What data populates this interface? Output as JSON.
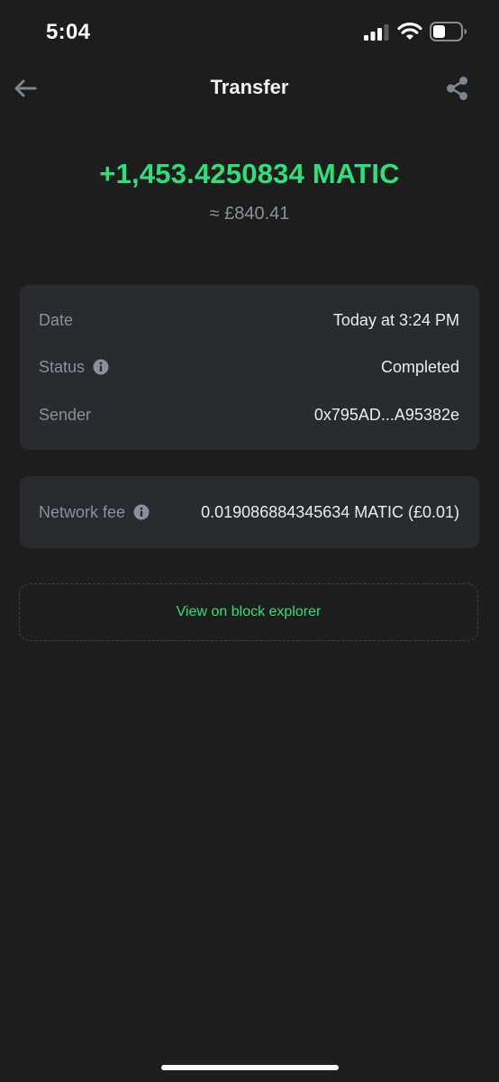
{
  "status_bar": {
    "time": "5:04",
    "icons": [
      "moon-icon",
      "cellular-signal-icon",
      "wifi-icon",
      "battery-icon"
    ]
  },
  "nav": {
    "title": "Transfer",
    "back_icon": "arrow-left-icon",
    "share_icon": "share-icon"
  },
  "transaction": {
    "amount": "+1,453.4250834 MATIC",
    "fiat_value": "≈ £840.41"
  },
  "details": {
    "date_label": "Date",
    "date_value": "Today at 3:24 PM",
    "status_label": "Status",
    "status_value": "Completed",
    "sender_label": "Sender",
    "sender_value": "0x795AD...A95382e"
  },
  "fee": {
    "label": "Network fee",
    "value": "0.019086884345634 MATIC (£0.01)"
  },
  "actions": {
    "explorer_label": "View on block explorer"
  },
  "colors": {
    "background": "#1d1d1d",
    "card": "#2a2b2e",
    "accent_green": "#2ee07a",
    "muted_text": "#8a8f99",
    "icon_gray": "#7d8593"
  }
}
